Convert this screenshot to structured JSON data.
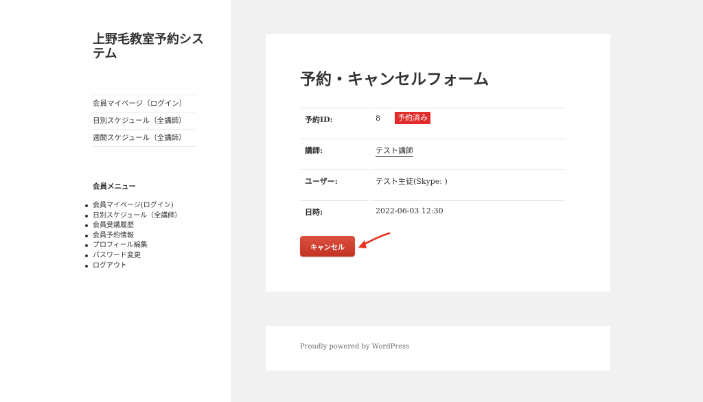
{
  "site": {
    "title": "上野毛教室予約システム"
  },
  "main_menu": [
    {
      "label": "会員マイページ（ログイン）"
    },
    {
      "label": "日別スケジュール（全講師）"
    },
    {
      "label": "週間スケジュール（全講師）"
    }
  ],
  "widget": {
    "title": "会員メニュー",
    "items": [
      {
        "label": "会員マイページ(ログイン)"
      },
      {
        "label": "日別スケジュール（全講師）"
      },
      {
        "label": "会員受講履歴"
      },
      {
        "label": "会員予約情報"
      },
      {
        "label": "プロフィール編集"
      },
      {
        "label": "パスワード変更"
      },
      {
        "label": "ログアウト"
      }
    ]
  },
  "form": {
    "title": "予約・キャンセルフォーム",
    "rows": [
      {
        "label": "予約ID:",
        "value": "8",
        "badge": "予約済み"
      },
      {
        "label": "講師:",
        "value": "テスト講師"
      },
      {
        "label": "ユーザー:",
        "value": "テスト生徒(Skype: )"
      },
      {
        "label": "日時:",
        "value": "2022-06-03 12:30"
      }
    ],
    "cancel_label": "キャンセル"
  },
  "footer": {
    "text": "Proudly powered by WordPress"
  },
  "colors": {
    "accent_red": "#e22b2b",
    "button_red": "#c9382a",
    "arrow_red": "#e8321e"
  }
}
